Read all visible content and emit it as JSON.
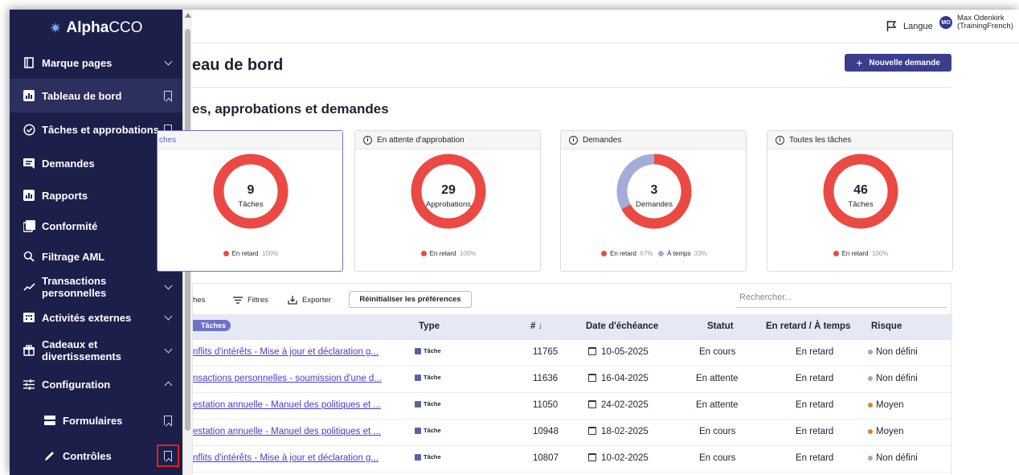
{
  "app": {
    "logo_bold": "Alpha",
    "logo_light": "CCO"
  },
  "sidebar": {
    "items": [
      {
        "label": "Marque pages",
        "trail": "chevron-down"
      },
      {
        "label": "Tableau de bord",
        "trail": "bookmark"
      },
      {
        "label": "Tâches et approbations",
        "trail": "bookmark"
      },
      {
        "label": "Demandes",
        "trail": "bookmark"
      },
      {
        "label": "Rapports",
        "trail": "chevron-down"
      },
      {
        "label": "Conformité",
        "trail": "chevron-down"
      },
      {
        "label": "Filtrage AML",
        "trail": "chevron-down"
      },
      {
        "label": "Transactions personnelles",
        "trail": "chevron-down"
      },
      {
        "label": "Activités externes",
        "trail": "chevron-down"
      },
      {
        "label": "Cadeaux et divertissements",
        "trail": "chevron-down"
      },
      {
        "label": "Configuration",
        "trail": "chevron-up"
      },
      {
        "label": "Formulaires",
        "trail": "bookmark"
      },
      {
        "label": "Contrôles",
        "trail": "bookmark"
      }
    ],
    "cadeaux_line1": "Cadeaux et",
    "cadeaux_line2": "divertissements"
  },
  "topbar": {
    "language": "Langue",
    "avatar_initials": "MO",
    "user_name": "Max Odenkirk",
    "user_org": "(TrainingFrench)"
  },
  "page": {
    "title": "eau de bord",
    "new_button": "Nouvelle demande",
    "section_title": "es, approbations et demandes"
  },
  "cards": [
    {
      "header": "ches",
      "number": "9",
      "sub": "Tâches",
      "legend": [
        {
          "label": "En retard",
          "pct": "100%",
          "color": "#ea4a43"
        }
      ]
    },
    {
      "header": "En attente d'approbation",
      "number": "29",
      "sub": "Approbations",
      "legend": [
        {
          "label": "En retard",
          "pct": "100%",
          "color": "#ea4a43"
        }
      ]
    },
    {
      "header": "Demandes",
      "number": "3",
      "sub": "Demandes",
      "legend": [
        {
          "label": "En retard",
          "pct": "67%",
          "color": "#ea4a43"
        },
        {
          "label": "À temps",
          "pct": "33%",
          "color": "#a4acd8"
        }
      ]
    },
    {
      "header": "Toutes les tâches",
      "number": "46",
      "sub": "Tâches",
      "legend": [
        {
          "label": "En retard",
          "pct": "100%",
          "color": "#ea4a43"
        }
      ]
    }
  ],
  "table": {
    "toolbar": {
      "columns_label": "hes",
      "filters_label": "Filtres",
      "export_label": "Exporter",
      "reset_label": "Réinitialiser les préférences",
      "search_placeholder": "Rechercher..."
    },
    "group_pill": "Tâches",
    "headers": {
      "type": "Type",
      "id": "#",
      "due": "Date d'échéance",
      "status": "Statut",
      "late": "En retard / À temps",
      "risk": "Risque"
    },
    "rows": [
      {
        "title": "nflits d'intérêts - Mise à jour et déclaration g...",
        "type": "Tâche",
        "id": "11765",
        "due": "10-05-2025",
        "status": "En cours",
        "late": "En retard",
        "risk": "Non défini",
        "risk_color": "#9ea6cf"
      },
      {
        "title": "nsactions personnelles - soumission d'une d...",
        "type": "Tâche",
        "id": "11636",
        "due": "16-04-2025",
        "status": "En attente",
        "late": "En retard",
        "risk": "Non défini",
        "risk_color": "#9ea6cf"
      },
      {
        "title": "estation annuelle - Manuel des politiques et ...",
        "type": "Tâche",
        "id": "11050",
        "due": "24-02-2025",
        "status": "En attente",
        "late": "En retard",
        "risk": "Moyen",
        "risk_color": "#e8801f"
      },
      {
        "title": "estation annuelle - Manuel des politiques et ...",
        "type": "Tâche",
        "id": "10948",
        "due": "18-02-2025",
        "status": "En cours",
        "late": "En retard",
        "risk": "Moyen",
        "risk_color": "#e8801f"
      },
      {
        "title": "nflits d'intérêts - Mise à jour et déclaration g...",
        "type": "Tâche",
        "id": "10807",
        "due": "10-02-2025",
        "status": "En cours",
        "late": "En retard",
        "risk": "Non défini",
        "risk_color": "#9ea6cf"
      }
    ]
  },
  "chart_data": [
    {
      "type": "pie",
      "title": "ches",
      "center_value": 9,
      "center_label": "Tâches",
      "slices": [
        {
          "name": "En retard",
          "value": 100
        }
      ]
    },
    {
      "type": "pie",
      "title": "En attente d'approbation",
      "center_value": 29,
      "center_label": "Approbations",
      "slices": [
        {
          "name": "En retard",
          "value": 100
        }
      ]
    },
    {
      "type": "pie",
      "title": "Demandes",
      "center_value": 3,
      "center_label": "Demandes",
      "slices": [
        {
          "name": "En retard",
          "value": 67
        },
        {
          "name": "À temps",
          "value": 33
        }
      ]
    },
    {
      "type": "pie",
      "title": "Toutes les tâches",
      "center_value": 46,
      "center_label": "Tâches",
      "slices": [
        {
          "name": "En retard",
          "value": 100
        }
      ]
    }
  ]
}
